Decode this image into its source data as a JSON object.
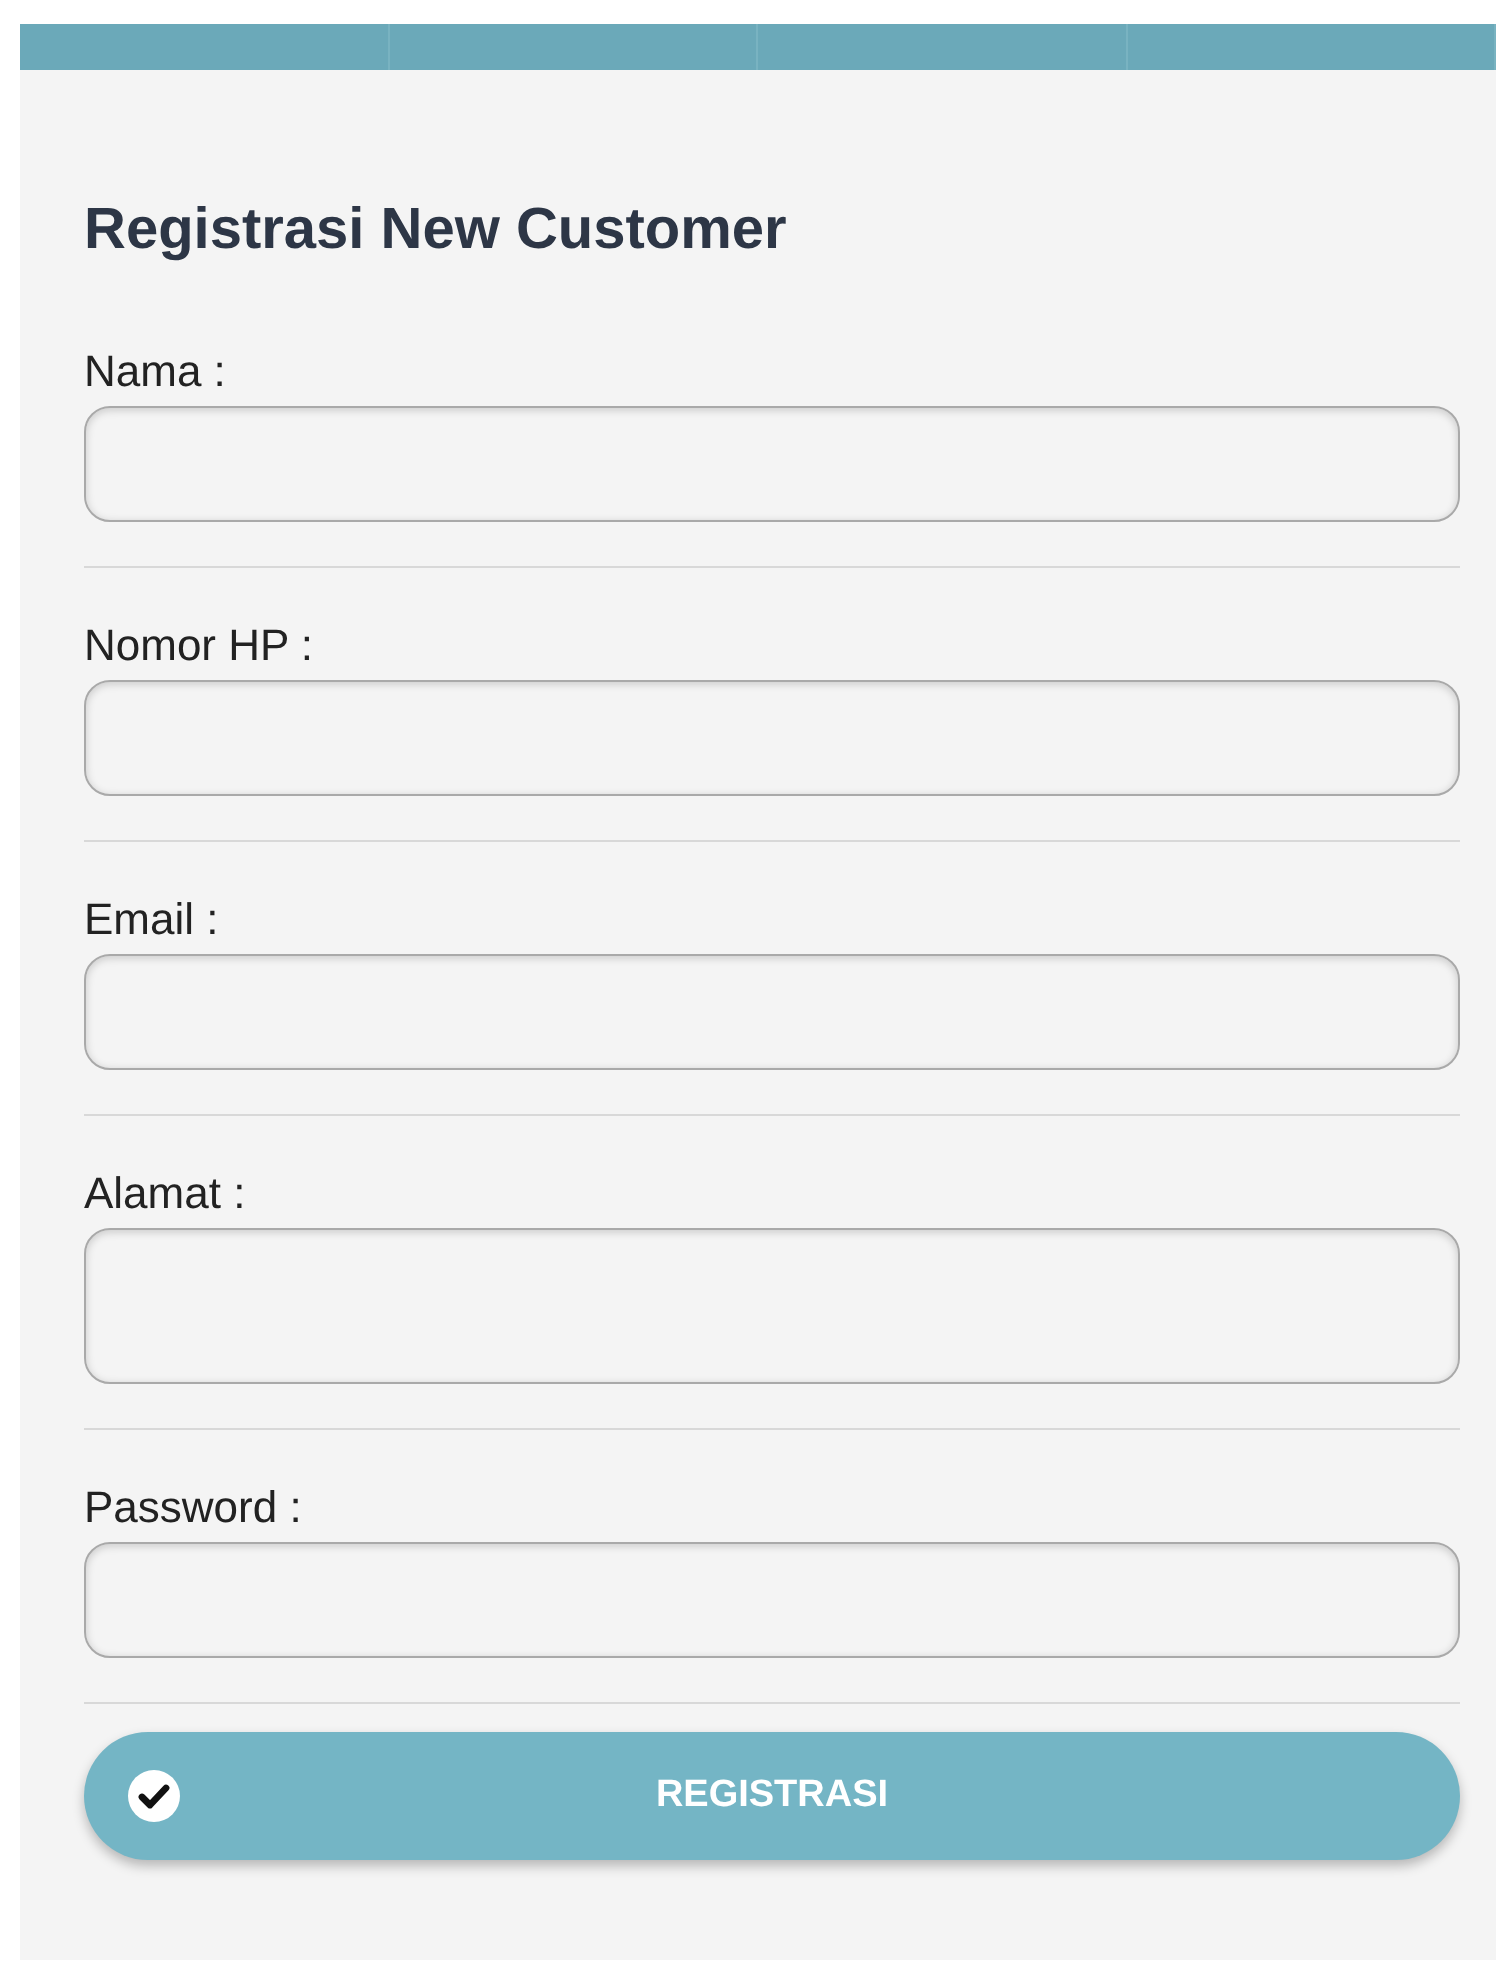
{
  "title": "Registrasi New Customer",
  "fields": [
    {
      "label": "Nama :",
      "kind": "input"
    },
    {
      "label": "Nomor HP :",
      "kind": "input"
    },
    {
      "label": "Email :",
      "kind": "input"
    },
    {
      "label": "Alamat :",
      "kind": "textarea"
    },
    {
      "label": "Password :",
      "kind": "input"
    }
  ],
  "button": {
    "label": "REGISTRASI"
  }
}
